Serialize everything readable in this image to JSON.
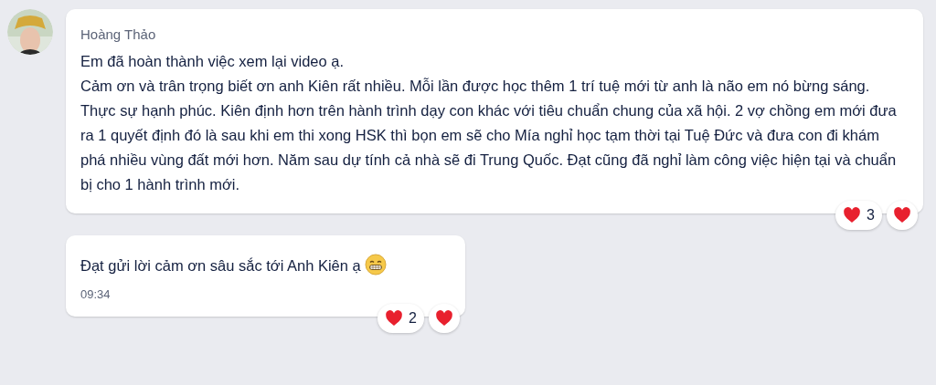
{
  "messages": [
    {
      "sender": "Hoàng Thảo",
      "paragraphs": [
        "Em đã hoàn thành việc xem lại video ạ.",
        "Cảm ơn và trân trọng biết ơn anh Kiên rất nhiều. Mỗi lần được học thêm 1 trí tuệ mới từ anh là não em nó bừng sáng. Thực sự hạnh phúc. Kiên định hơn trên hành trình dạy con khác với tiêu chuẩn chung của xã hội. 2 vợ chồng em mới đưa ra 1 quyết định đó là sau khi em thi xong HSK thì bọn em sẽ cho Mía nghỉ học tạm thời tại Tuệ Đức và đưa con đi khám phá nhiều vùng đất mới hơn. Năm sau dự tính cả nhà sẽ đi Trung Quốc. Đạt cũng đã nghỉ làm công việc hiện tại và chuẩn bị cho 1 hành trình mới."
      ],
      "reaction_count": "3"
    },
    {
      "paragraphs": [
        "Đạt gửi lời cảm ơn sâu sắc tới Anh Kiên ạ"
      ],
      "has_emoji": true,
      "time": "09:34",
      "reaction_count": "2"
    }
  ]
}
